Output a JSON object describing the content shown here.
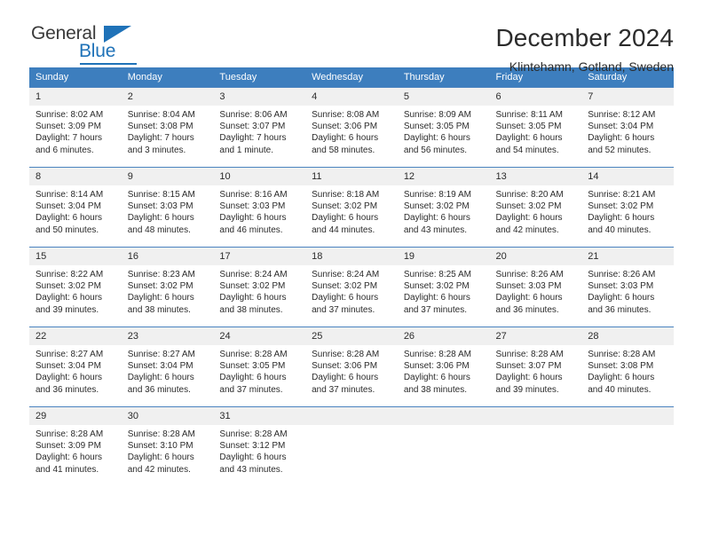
{
  "brand": {
    "name_top": "General",
    "name_bottom": "Blue",
    "accent_color": "#1f72b8"
  },
  "header": {
    "title": "December 2024",
    "subtitle": "Klintehamn, Gotland, Sweden"
  },
  "calendar": {
    "header_bg": "#3d7ebe",
    "daynum_bg": "#f0f0f0",
    "weekday_headers": [
      "Sunday",
      "Monday",
      "Tuesday",
      "Wednesday",
      "Thursday",
      "Friday",
      "Saturday"
    ],
    "weeks": [
      [
        {
          "day": "1",
          "sunrise": "Sunrise: 8:02 AM",
          "sunset": "Sunset: 3:09 PM",
          "daylight_line1": "Daylight: 7 hours",
          "daylight_line2": "and 6 minutes."
        },
        {
          "day": "2",
          "sunrise": "Sunrise: 8:04 AM",
          "sunset": "Sunset: 3:08 PM",
          "daylight_line1": "Daylight: 7 hours",
          "daylight_line2": "and 3 minutes."
        },
        {
          "day": "3",
          "sunrise": "Sunrise: 8:06 AM",
          "sunset": "Sunset: 3:07 PM",
          "daylight_line1": "Daylight: 7 hours",
          "daylight_line2": "and 1 minute."
        },
        {
          "day": "4",
          "sunrise": "Sunrise: 8:08 AM",
          "sunset": "Sunset: 3:06 PM",
          "daylight_line1": "Daylight: 6 hours",
          "daylight_line2": "and 58 minutes."
        },
        {
          "day": "5",
          "sunrise": "Sunrise: 8:09 AM",
          "sunset": "Sunset: 3:05 PM",
          "daylight_line1": "Daylight: 6 hours",
          "daylight_line2": "and 56 minutes."
        },
        {
          "day": "6",
          "sunrise": "Sunrise: 8:11 AM",
          "sunset": "Sunset: 3:05 PM",
          "daylight_line1": "Daylight: 6 hours",
          "daylight_line2": "and 54 minutes."
        },
        {
          "day": "7",
          "sunrise": "Sunrise: 8:12 AM",
          "sunset": "Sunset: 3:04 PM",
          "daylight_line1": "Daylight: 6 hours",
          "daylight_line2": "and 52 minutes."
        }
      ],
      [
        {
          "day": "8",
          "sunrise": "Sunrise: 8:14 AM",
          "sunset": "Sunset: 3:04 PM",
          "daylight_line1": "Daylight: 6 hours",
          "daylight_line2": "and 50 minutes."
        },
        {
          "day": "9",
          "sunrise": "Sunrise: 8:15 AM",
          "sunset": "Sunset: 3:03 PM",
          "daylight_line1": "Daylight: 6 hours",
          "daylight_line2": "and 48 minutes."
        },
        {
          "day": "10",
          "sunrise": "Sunrise: 8:16 AM",
          "sunset": "Sunset: 3:03 PM",
          "daylight_line1": "Daylight: 6 hours",
          "daylight_line2": "and 46 minutes."
        },
        {
          "day": "11",
          "sunrise": "Sunrise: 8:18 AM",
          "sunset": "Sunset: 3:02 PM",
          "daylight_line1": "Daylight: 6 hours",
          "daylight_line2": "and 44 minutes."
        },
        {
          "day": "12",
          "sunrise": "Sunrise: 8:19 AM",
          "sunset": "Sunset: 3:02 PM",
          "daylight_line1": "Daylight: 6 hours",
          "daylight_line2": "and 43 minutes."
        },
        {
          "day": "13",
          "sunrise": "Sunrise: 8:20 AM",
          "sunset": "Sunset: 3:02 PM",
          "daylight_line1": "Daylight: 6 hours",
          "daylight_line2": "and 42 minutes."
        },
        {
          "day": "14",
          "sunrise": "Sunrise: 8:21 AM",
          "sunset": "Sunset: 3:02 PM",
          "daylight_line1": "Daylight: 6 hours",
          "daylight_line2": "and 40 minutes."
        }
      ],
      [
        {
          "day": "15",
          "sunrise": "Sunrise: 8:22 AM",
          "sunset": "Sunset: 3:02 PM",
          "daylight_line1": "Daylight: 6 hours",
          "daylight_line2": "and 39 minutes."
        },
        {
          "day": "16",
          "sunrise": "Sunrise: 8:23 AM",
          "sunset": "Sunset: 3:02 PM",
          "daylight_line1": "Daylight: 6 hours",
          "daylight_line2": "and 38 minutes."
        },
        {
          "day": "17",
          "sunrise": "Sunrise: 8:24 AM",
          "sunset": "Sunset: 3:02 PM",
          "daylight_line1": "Daylight: 6 hours",
          "daylight_line2": "and 38 minutes."
        },
        {
          "day": "18",
          "sunrise": "Sunrise: 8:24 AM",
          "sunset": "Sunset: 3:02 PM",
          "daylight_line1": "Daylight: 6 hours",
          "daylight_line2": "and 37 minutes."
        },
        {
          "day": "19",
          "sunrise": "Sunrise: 8:25 AM",
          "sunset": "Sunset: 3:02 PM",
          "daylight_line1": "Daylight: 6 hours",
          "daylight_line2": "and 37 minutes."
        },
        {
          "day": "20",
          "sunrise": "Sunrise: 8:26 AM",
          "sunset": "Sunset: 3:03 PM",
          "daylight_line1": "Daylight: 6 hours",
          "daylight_line2": "and 36 minutes."
        },
        {
          "day": "21",
          "sunrise": "Sunrise: 8:26 AM",
          "sunset": "Sunset: 3:03 PM",
          "daylight_line1": "Daylight: 6 hours",
          "daylight_line2": "and 36 minutes."
        }
      ],
      [
        {
          "day": "22",
          "sunrise": "Sunrise: 8:27 AM",
          "sunset": "Sunset: 3:04 PM",
          "daylight_line1": "Daylight: 6 hours",
          "daylight_line2": "and 36 minutes."
        },
        {
          "day": "23",
          "sunrise": "Sunrise: 8:27 AM",
          "sunset": "Sunset: 3:04 PM",
          "daylight_line1": "Daylight: 6 hours",
          "daylight_line2": "and 36 minutes."
        },
        {
          "day": "24",
          "sunrise": "Sunrise: 8:28 AM",
          "sunset": "Sunset: 3:05 PM",
          "daylight_line1": "Daylight: 6 hours",
          "daylight_line2": "and 37 minutes."
        },
        {
          "day": "25",
          "sunrise": "Sunrise: 8:28 AM",
          "sunset": "Sunset: 3:06 PM",
          "daylight_line1": "Daylight: 6 hours",
          "daylight_line2": "and 37 minutes."
        },
        {
          "day": "26",
          "sunrise": "Sunrise: 8:28 AM",
          "sunset": "Sunset: 3:06 PM",
          "daylight_line1": "Daylight: 6 hours",
          "daylight_line2": "and 38 minutes."
        },
        {
          "day": "27",
          "sunrise": "Sunrise: 8:28 AM",
          "sunset": "Sunset: 3:07 PM",
          "daylight_line1": "Daylight: 6 hours",
          "daylight_line2": "and 39 minutes."
        },
        {
          "day": "28",
          "sunrise": "Sunrise: 8:28 AM",
          "sunset": "Sunset: 3:08 PM",
          "daylight_line1": "Daylight: 6 hours",
          "daylight_line2": "and 40 minutes."
        }
      ],
      [
        {
          "day": "29",
          "sunrise": "Sunrise: 8:28 AM",
          "sunset": "Sunset: 3:09 PM",
          "daylight_line1": "Daylight: 6 hours",
          "daylight_line2": "and 41 minutes."
        },
        {
          "day": "30",
          "sunrise": "Sunrise: 8:28 AM",
          "sunset": "Sunset: 3:10 PM",
          "daylight_line1": "Daylight: 6 hours",
          "daylight_line2": "and 42 minutes."
        },
        {
          "day": "31",
          "sunrise": "Sunrise: 8:28 AM",
          "sunset": "Sunset: 3:12 PM",
          "daylight_line1": "Daylight: 6 hours",
          "daylight_line2": "and 43 minutes."
        },
        {
          "day": "",
          "sunrise": "",
          "sunset": "",
          "daylight_line1": "",
          "daylight_line2": ""
        },
        {
          "day": "",
          "sunrise": "",
          "sunset": "",
          "daylight_line1": "",
          "daylight_line2": ""
        },
        {
          "day": "",
          "sunrise": "",
          "sunset": "",
          "daylight_line1": "",
          "daylight_line2": ""
        },
        {
          "day": "",
          "sunrise": "",
          "sunset": "",
          "daylight_line1": "",
          "daylight_line2": ""
        }
      ]
    ]
  }
}
